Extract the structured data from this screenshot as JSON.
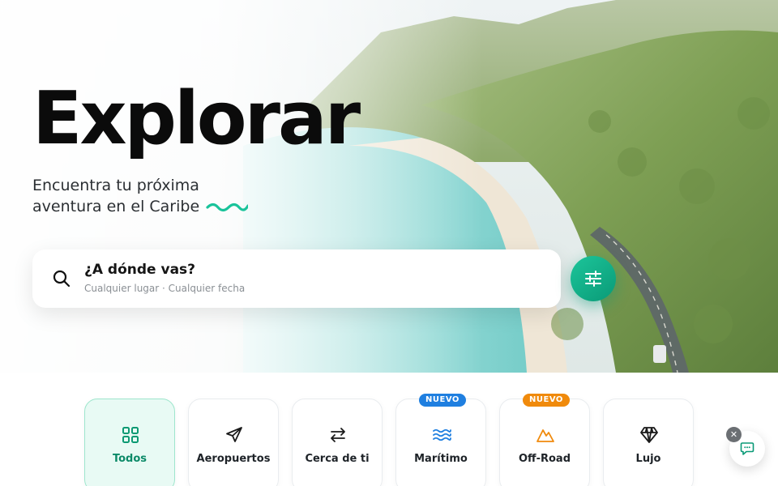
{
  "hero": {
    "title": "Explorar",
    "subtitle_line1": "Encuentra tu próxima",
    "subtitle_line2": "aventura en el Caribe",
    "accent_color": "#19c39a"
  },
  "search": {
    "title": "¿A dónde vas?",
    "subtitle": "Cualquier lugar · Cualquier fecha",
    "filter_icon": "sliders-icon"
  },
  "categories": [
    {
      "label": "Todos",
      "icon": "grid-icon",
      "active": true
    },
    {
      "label": "Aeropuertos",
      "icon": "plane-icon"
    },
    {
      "label": "Cerca de ti",
      "icon": "arrows-swap-icon"
    },
    {
      "label": "Marítimo",
      "icon": "waves-icon",
      "badge": "NUEVO",
      "badge_color": "#1f7fe0"
    },
    {
      "label": "Off-Road",
      "icon": "mountain-icon",
      "badge": "NUEVO",
      "badge_color": "#f08a0c"
    },
    {
      "label": "Lujo",
      "icon": "diamond-icon"
    }
  ],
  "chat": {
    "close_symbol": "✕",
    "icon": "chat-bubble-icon"
  }
}
